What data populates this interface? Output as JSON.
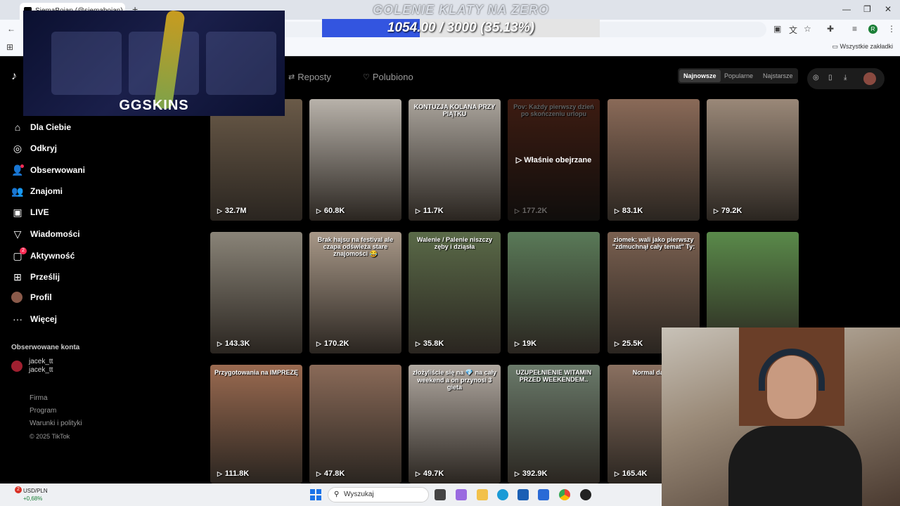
{
  "browser": {
    "tab_title": "SiemaBojan (@siemabojan)",
    "new_tab": "+",
    "bookmarks_all": "Wszystkie zakładki",
    "profile_letter": "R"
  },
  "overlay": {
    "goal_title": "GOLENIE KLATY NA ZERO",
    "goal_current": 1054.0,
    "goal_target": 3000,
    "goal_text": "1054.00 / 3000 (35.13%)",
    "goal_fraction": 0.3513,
    "sponsor_logo": "GGSKINS"
  },
  "tiktok": {
    "logo": "TikTok",
    "sidebar": [
      {
        "label": "Dla Ciebie",
        "icon": "home-icon"
      },
      {
        "label": "Odkryj",
        "icon": "compass-icon"
      },
      {
        "label": "Obserwowani",
        "icon": "following-icon"
      },
      {
        "label": "Znajomi",
        "icon": "friends-icon"
      },
      {
        "label": "LIVE",
        "icon": "live-icon"
      },
      {
        "label": "Wiadomości",
        "icon": "messages-icon"
      },
      {
        "label": "Aktywność",
        "icon": "activity-icon",
        "badge": "2"
      },
      {
        "label": "Prześlij",
        "icon": "upload-icon"
      },
      {
        "label": "Profil",
        "icon": "profile-avatar"
      },
      {
        "label": "Więcej",
        "icon": "more-icon"
      }
    ],
    "followed_title": "Obserwowane konta",
    "followed": [
      {
        "name": "jacek_tt",
        "handle": "jacek_tt"
      }
    ],
    "footer": [
      "Firma",
      "Program",
      "Warunki i polityki"
    ],
    "copyright": "© 2025 TikTok",
    "tabs": {
      "reposts": "Reposty",
      "liked": "Polubiono"
    },
    "sort": {
      "newest": "Najnowsze",
      "popular": "Popularne",
      "oldest": "Najstarsze"
    },
    "watched_label": "Właśnie obejrzane",
    "videos": [
      {
        "views": "32.7M",
        "caption": "",
        "color": "#6a5a48"
      },
      {
        "views": "60.8K",
        "caption": "",
        "color": "#b8b2aa"
      },
      {
        "views": "11.7K",
        "caption": "KONTUZJA KOLANA PRZY PIĄTKU",
        "color": "#aaa49c"
      },
      {
        "views": "177.2K",
        "caption": "Pov: Każdy pierwszy dzień po skończeniu urlopu",
        "color": "#a04a30",
        "watched": true
      },
      {
        "views": "83.1K",
        "caption": "",
        "color": "#8a6a58"
      },
      {
        "views": "79.2K",
        "caption": "",
        "color": "#9a8878"
      },
      {
        "views": "143.3K",
        "caption": "",
        "color": "#8a8478"
      },
      {
        "views": "170.2K",
        "caption": "Brak hajsu na festival ale czapa odświeża stare znajomości 😂",
        "color": "#a89888"
      },
      {
        "views": "35.8K",
        "caption": "Walenie / Palenie niszczy zęby i dziąsła",
        "color": "#5a6a48"
      },
      {
        "views": "19K",
        "caption": "",
        "color": "#5a7a58"
      },
      {
        "views": "25.5K",
        "caption": "ziomek: wali jako pierwszy \"zdmuchnął cały temat\" Ty:",
        "color": "#7a6050"
      },
      {
        "views": "",
        "caption": "",
        "color": "#5a8a4a"
      },
      {
        "views": "111.8K",
        "caption": "Przygotowania na IMPREZĘ",
        "color": "#9a6a50"
      },
      {
        "views": "47.8K",
        "caption": "",
        "color": "#8a6a58"
      },
      {
        "views": "49.7K",
        "caption": "złożyliście się na 💎 na cały weekend a on przynosi 3 gieta",
        "color": "#b0a8a0"
      },
      {
        "views": "392.9K",
        "caption": "UZUPEŁNIENIE WITAMIN PRZED WEEKENDEM..",
        "color": "#6a7a6a"
      },
      {
        "views": "165.4K",
        "caption": "Normal day in",
        "color": "#8a7060"
      }
    ]
  },
  "taskbar": {
    "weather_title": "USD/PLN",
    "weather_change": "+0,68%",
    "weather_badge": "2",
    "search_placeholder": "Wyszukaj"
  }
}
